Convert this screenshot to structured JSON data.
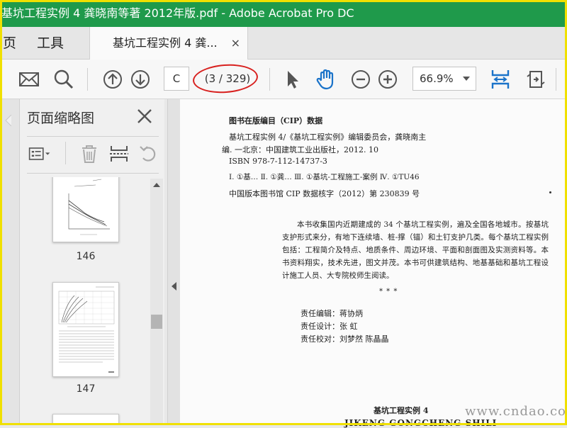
{
  "window": {
    "title": "基坑工程实例 4 龚晓南等著 2012年版.pdf - Adobe Acrobat Pro DC",
    "title_bar_color": "#1f9a4b"
  },
  "nav_tabs": [
    {
      "label": "页"
    },
    {
      "label": "工具"
    }
  ],
  "document_tab": {
    "label": "基坑工程实例 4 龚...",
    "close_symbol": "×"
  },
  "toolbar": {
    "icons": [
      "mail-icon",
      "search-icon",
      "page-up-icon",
      "page-down-icon",
      "select-arrow-icon",
      "hand-icon",
      "zoom-out-icon",
      "zoom-in-icon",
      "fit-page-icon",
      "rotate-icon"
    ],
    "page_input": "C",
    "page_count": "(3 / 329)",
    "zoom": "66.9%",
    "accent_color": "#1a73c9",
    "annotation_color": "#d8201e"
  },
  "panel": {
    "title": "页面缩略图",
    "thumbnails": [
      {
        "label": "146"
      },
      {
        "label": "147"
      }
    ]
  },
  "document": {
    "cip_heading": "图书在版编目（CIP）数据",
    "cip_line1": "基坑工程实例 4/《基坑工程实例》编辑委员会，龚晓南主",
    "cip_line2": "编. 一北京：中国建筑工业出版社，2012. 10",
    "isbn": "ISBN 978-7-112-14737-3",
    "classification": "Ⅰ. ①基…  Ⅱ. ①龚…  Ⅲ. ①基坑-工程施工-案例  Ⅳ. ①TU46",
    "cip_number": "中国版本图书馆 CIP 数据核字（2012）第 230839 号",
    "description": "本书收集国内近期建成的 34 个基坑工程实例，遍及全国各地城市。按基坑支护形式来分，有地下连续墙、桩-撑（锚）和土钉支护几类。每个基坑工程实例包括：工程简介及特点、地质条件、周边环境、平面和剖面图及实测资料等。本书资料翔实，技术先进，图文并茂。本书可供建筑结构、地基基础和基坑工程设计施工人员、大专院校师生阅读。",
    "separator": "*          *          *",
    "editor": "责任编辑：蒋协炳",
    "designer": "责任设计：张  虹",
    "proofreader": "责任校对：刘梦然  陈晶晶",
    "book_title": "基坑工程实例 4",
    "book_title_pinyin": "JIKENG GONGCHENG SHILI"
  },
  "watermark": "www.cndao.com"
}
